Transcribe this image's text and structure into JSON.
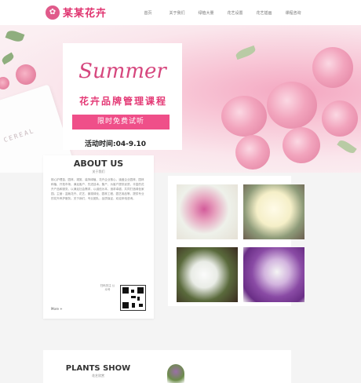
{
  "header": {
    "logo_icon": "flower-logo-icon",
    "logo_text": "某某花卉",
    "nav": [
      "首页",
      "关于我们",
      "绿植大量",
      "花艺设置",
      "花艺插画",
      "课程咨询"
    ]
  },
  "hero": {
    "script_title": "Summer",
    "subtitle": "花卉品牌管理课程",
    "cta": "限时免费试听",
    "date_line": "活动时间:04-9.10",
    "card_text": "CEREAL"
  },
  "about": {
    "title": "ABOUT US",
    "subtitle": "关于我们",
    "paragraph": "核心护理苗、园林、观赏、装饰绿植、花卉企业核心，涵盖企业园林、园林种植、开拓市场，满足客户、先进技术。集产、为客户提供优质、丰富的花卉产品和服务，以满足社会需求，以诚信为本、追求卓越，共同打造绿色家园。主营：盆栽花卉、花艺、景观绿化、园林工程、园艺用品等，提供专业的花卉养护服务。关于我们，专业团队，品质保证，欢迎来电咨询。",
    "more": "More +",
    "qr_caption": "扫码关注 公众号",
    "qr_icon": "qr-code-icon"
  },
  "section2": {
    "title": "PLANTS SHOW",
    "subtitle": "花艺欣赏"
  }
}
